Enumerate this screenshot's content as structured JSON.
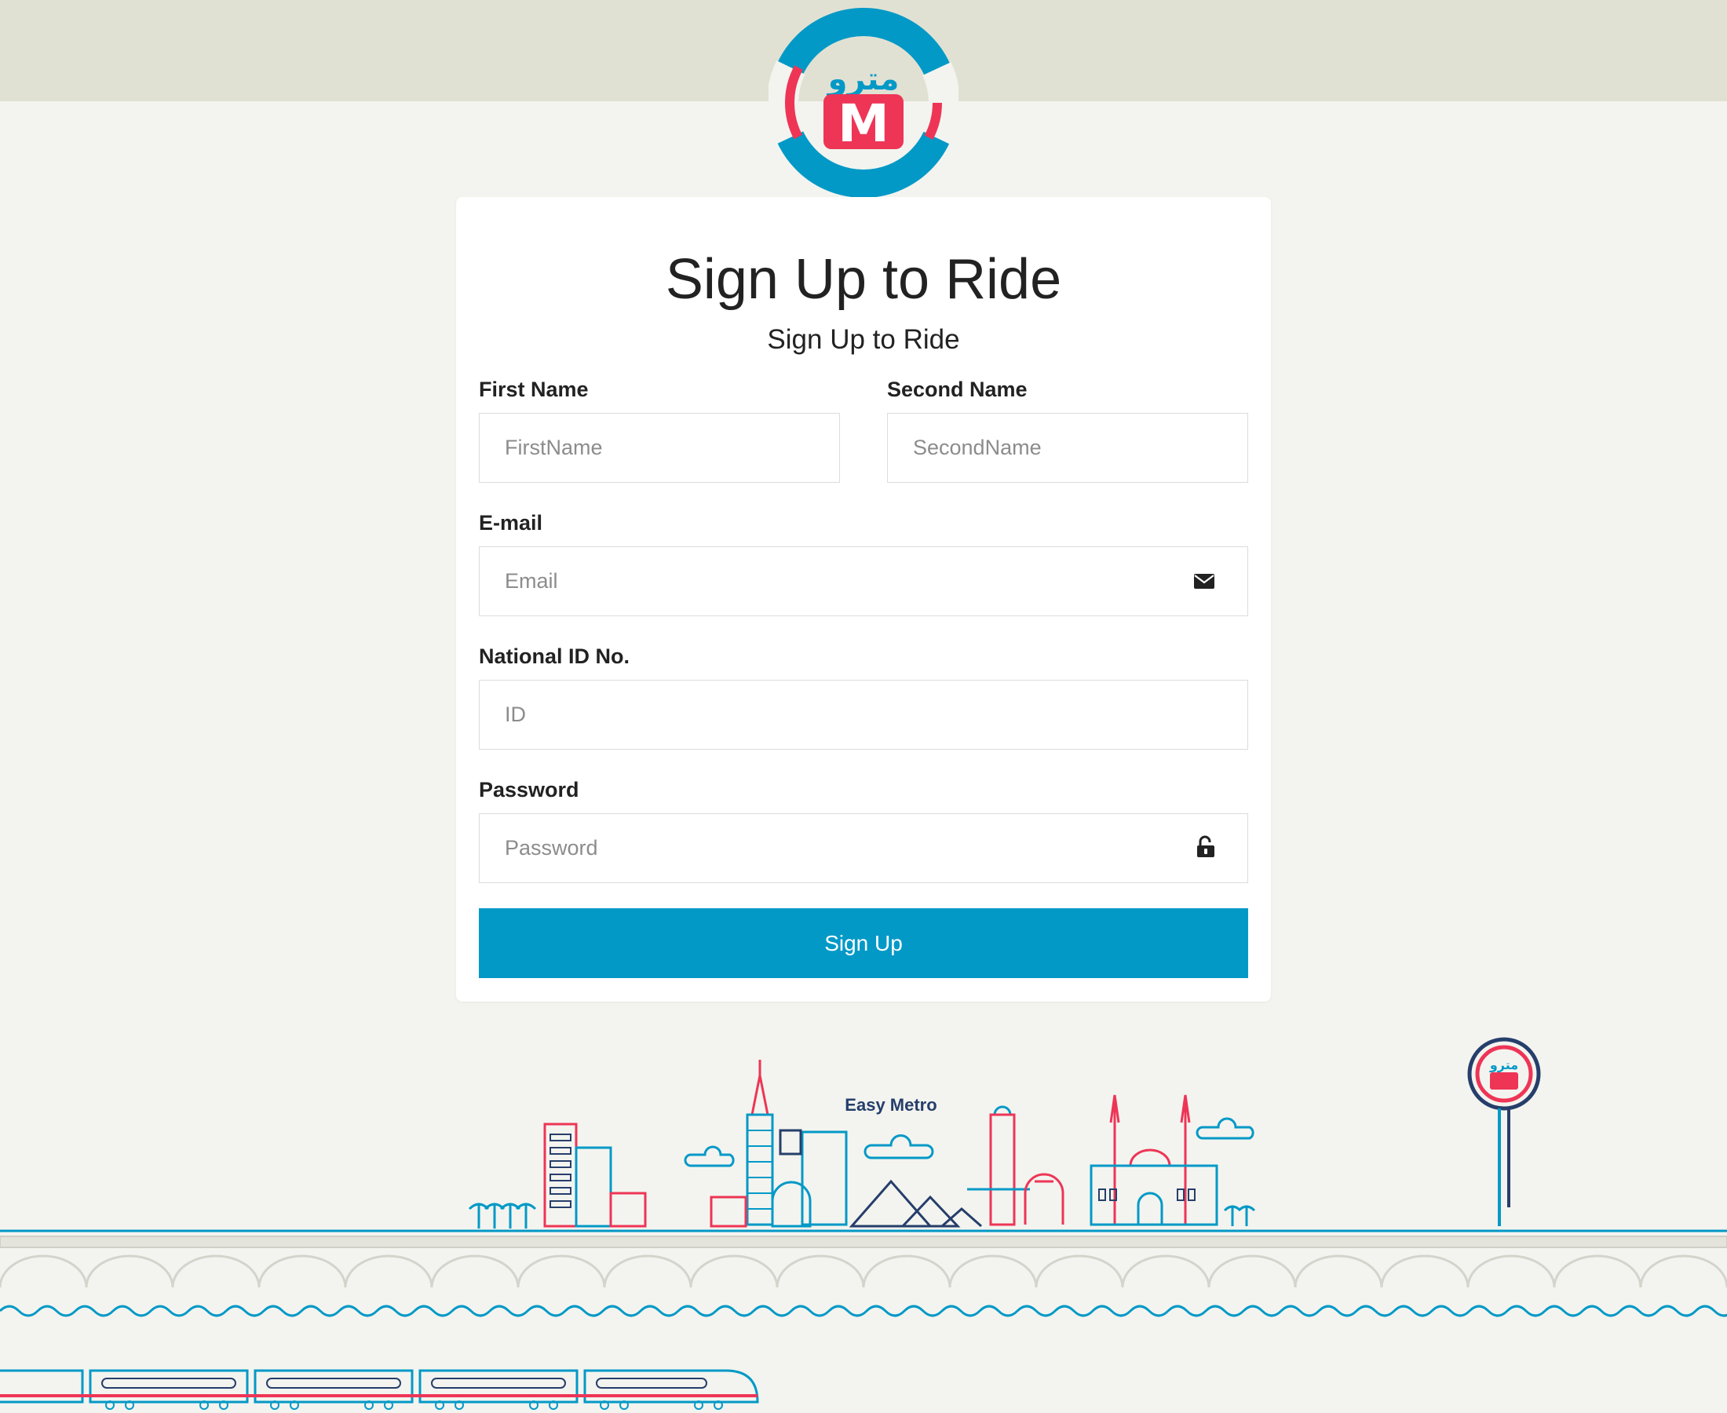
{
  "header": {
    "logo": {
      "icon": "metro-logo-icon",
      "arabic_text": "مترو",
      "letter": "M"
    }
  },
  "form": {
    "title": "Sign Up to Ride",
    "subtitle": "Sign Up to Ride",
    "fields": {
      "first_name": {
        "label": "First Name",
        "placeholder": "FirstName",
        "value": ""
      },
      "second_name": {
        "label": "Second Name",
        "placeholder": "SecondName",
        "value": ""
      },
      "email": {
        "label": "E-mail",
        "placeholder": "Email",
        "value": "",
        "icon": "envelope-icon"
      },
      "national_id": {
        "label": "National ID No.",
        "placeholder": "ID",
        "value": ""
      },
      "password": {
        "label": "Password",
        "placeholder": "Password",
        "value": "",
        "icon": "unlock-icon"
      }
    },
    "submit_label": "Sign Up"
  },
  "scene": {
    "caption": "Easy Metro",
    "sign_text": "مترو"
  },
  "colors": {
    "brand_blue": "#0399c7",
    "brand_red": "#ee3556",
    "navy": "#263e6b",
    "top_bar": "#e1e1d3",
    "page_background": "#f3f4ef"
  }
}
